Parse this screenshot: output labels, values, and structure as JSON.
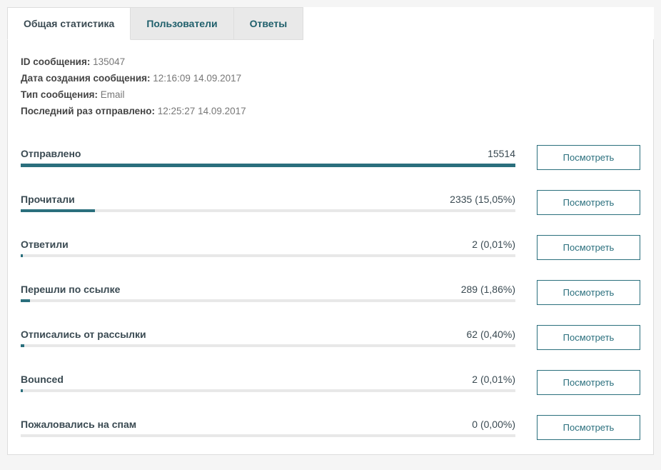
{
  "tabs": {
    "general_stats": "Общая статистика",
    "users": "Пользователи",
    "answers": "Ответы"
  },
  "meta": {
    "id_label": "ID сообщения:",
    "id_value": "135047",
    "created_label": "Дата создания сообщения:",
    "created_value": "12:16:09 14.09.2017",
    "type_label": "Тип сообщения:",
    "type_value": "Email",
    "last_sent_label": "Последний раз отправлено:",
    "last_sent_value": "12:25:27 14.09.2017"
  },
  "view_button_label": "Посмотреть",
  "stats": {
    "sent": {
      "label": "Отправлено",
      "value": "15514",
      "progress": 100
    },
    "read": {
      "label": "Прочитали",
      "value": "2335 (15,05%)",
      "progress": 15.05
    },
    "answered": {
      "label": "Ответили",
      "value": "2 (0,01%)",
      "progress": 0.5
    },
    "clicked": {
      "label": "Перешли по ссылке",
      "value": "289 (1,86%)",
      "progress": 1.86
    },
    "unsubscribed": {
      "label": "Отписались от рассылки",
      "value": "62 (0,40%)",
      "progress": 0.7
    },
    "bounced": {
      "label": "Bounced",
      "value": "2 (0,01%)",
      "progress": 0.5
    },
    "spam": {
      "label": "Пожаловались на спам",
      "value": "0 (0,00%)",
      "progress": 0
    }
  }
}
